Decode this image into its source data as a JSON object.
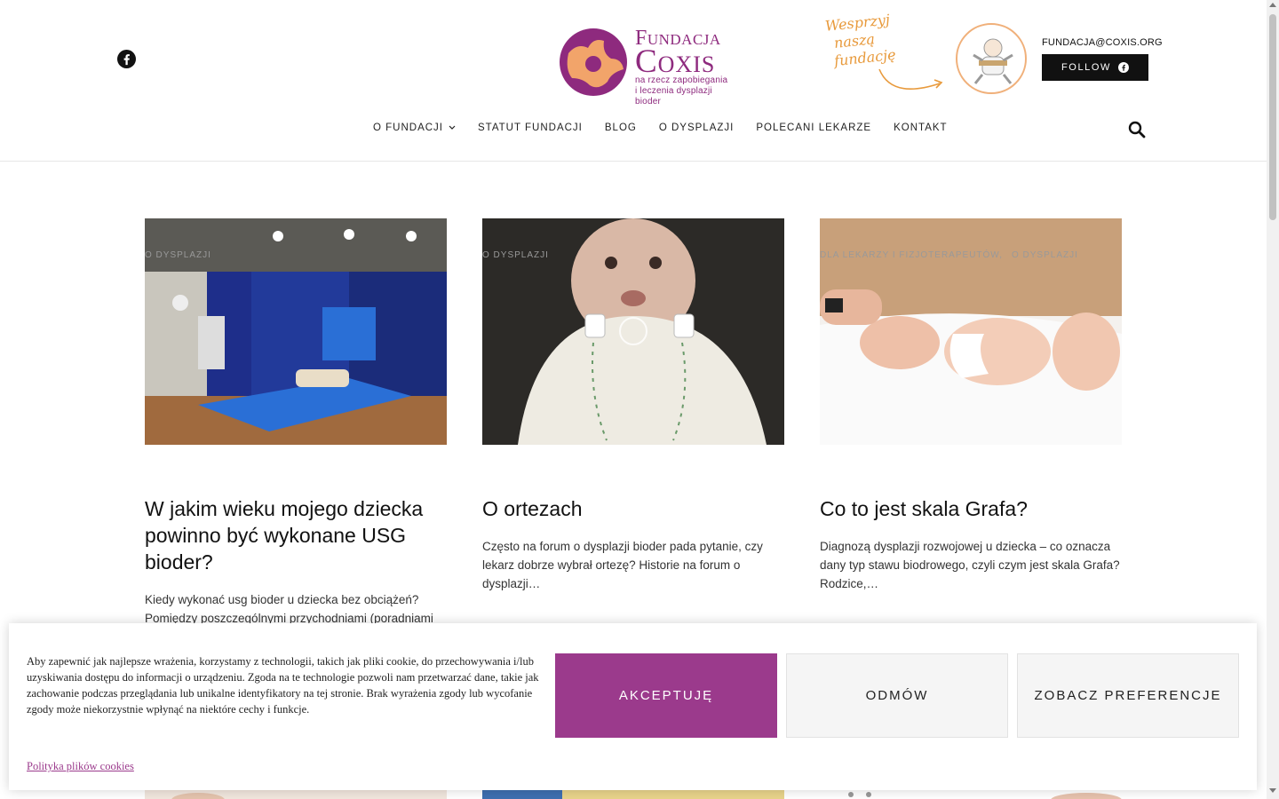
{
  "header": {
    "logo": {
      "line1": "Fundacja",
      "line2": "Coxis",
      "tagline1": "na rzecz zapobiegania",
      "tagline2": "i leczenia dysplazji bioder"
    },
    "support_text_1": "Wesprzyj",
    "support_text_2": "naszą",
    "support_text_3": "fundację",
    "email": "FUNDACJA@COXIS.ORG",
    "follow_label": "FOLLOW",
    "brand_color": "#8e2a7e",
    "accent_color": "#e89a3c"
  },
  "nav": {
    "items": [
      {
        "label": "O FUNDACJI",
        "has_dropdown": true
      },
      {
        "label": "STATUT FUNDACJI"
      },
      {
        "label": "BLOG"
      },
      {
        "label": "O DYSPLAZJI"
      },
      {
        "label": "POLECANI LEKARZE"
      },
      {
        "label": "KONTAKT"
      }
    ]
  },
  "posts": [
    {
      "categories": [
        "O DYSPLAZJI"
      ],
      "title": "W jakim wieku mojego dziecka powinno być wykonane USG bioder?",
      "excerpt": "Kiedy wykonać usg bioder u dziecka bez obciążeń? Pomiędzy poszczególnymi przychodniami (poradniami"
    },
    {
      "categories": [
        "O DYSPLAZJI"
      ],
      "title": "O ortezach",
      "excerpt": "Często na forum o dysplazji bioder pada pytanie, czy lekarz dobrze wybrał ortezę? Historie na forum o dysplazji…"
    },
    {
      "categories": [
        "DLA LEKARZY I FIZJOTERAPEUTÓW",
        "O DYSPLAZJI"
      ],
      "title": "Co to jest skala Grafa?",
      "excerpt": "Diagnozą dysplazji rozwojowej u dziecka – co oznacza dany typ stawu biodrowego, czyli czym jest skala Grafa? Rodzice,…"
    }
  ],
  "cookie": {
    "text": "Aby zapewnić jak najlepsze wrażenia, korzystamy z technologii, takich jak pliki cookie, do przechowywania i/lub uzyskiwania dostępu do informacji o urządzeniu. Zgoda na te technologie pozwoli nam przetwarzać dane, takie jak zachowanie podczas przeglądania lub unikalne identyfikatory na tej stronie. Brak wyrażenia zgody lub wycofanie zgody może niekorzystnie wpłynąć na niektóre cechy i funkcje.",
    "accept_label": "AKCEPTUJĘ",
    "deny_label": "ODMÓW",
    "prefs_label": "ZOBACZ PREFERENCJE",
    "policy_link": "Polityka plików cookies",
    "accept_color": "#9b3a8c"
  }
}
